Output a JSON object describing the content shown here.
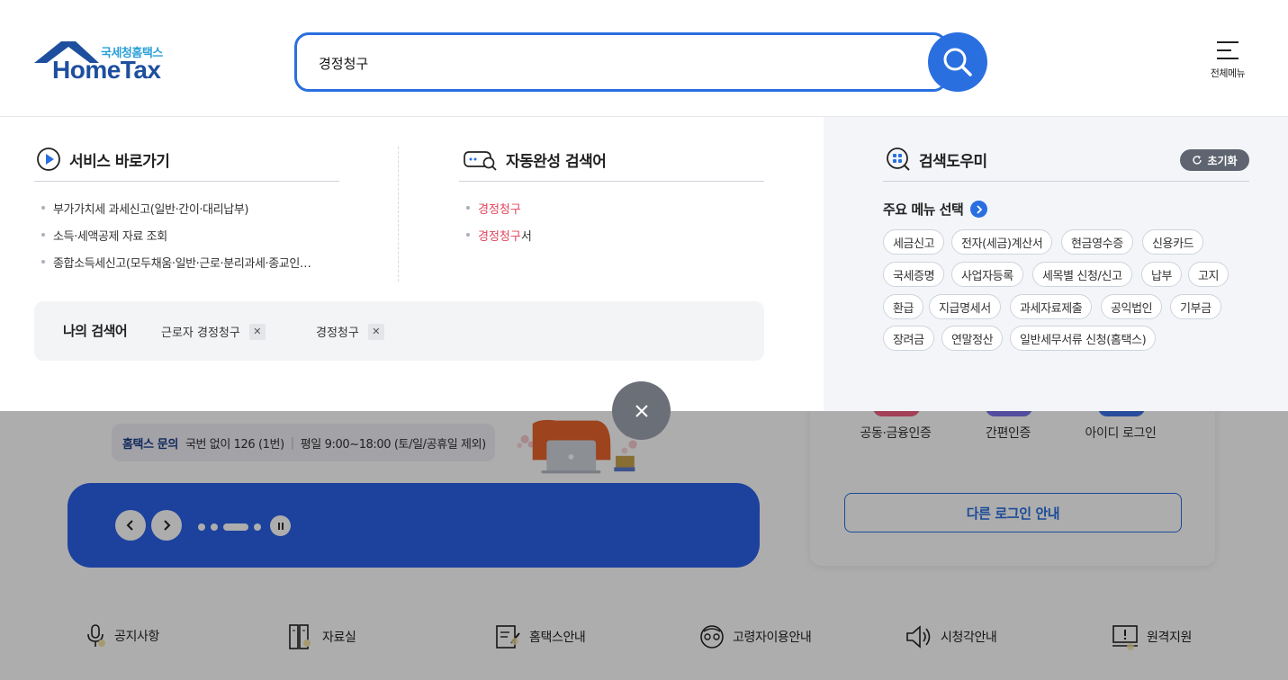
{
  "header": {
    "logo_sub": "국세청홈택스",
    "logo_main": "HomeTax",
    "search_value": "경정청구",
    "menu_label": "전체메뉴"
  },
  "services": {
    "title": "서비스 바로가기",
    "items": [
      "부가가치세 과세신고(일반·간이·대리납부)",
      "소득·세액공제 자료 조회",
      "종합소득세신고(모두채움·일반·근로·분리과세·종교인…"
    ]
  },
  "autocomplete": {
    "title": "자동완성 검색어",
    "items": [
      {
        "match": "경정청구",
        "rest": ""
      },
      {
        "match": "경정청구",
        "rest": "서"
      }
    ]
  },
  "my_search": {
    "title": "나의 검색어",
    "items": [
      "근로자 경정청구",
      "경정청구"
    ]
  },
  "helper": {
    "title": "검색도우미",
    "reset_label": "초기화",
    "subtitle": "주요 메뉴 선택",
    "tags": [
      "세금신고",
      "전자(세금)계산서",
      "현금영수증",
      "신용카드",
      "국세증명",
      "사업자등록",
      "세목별 신청/신고",
      "납부",
      "고지",
      "환급",
      "지급명세서",
      "과세자료제출",
      "공익법인",
      "기부금",
      "장려금",
      "연말정산",
      "일반세무서류 신청(홈택스)"
    ]
  },
  "background": {
    "inquiry_title": "홈택스 문의",
    "inquiry_phone": "국번 없이 126 (1번)",
    "inquiry_hours": "평일 9:00~18:00 (토/일/공휴일 제외)",
    "login_options": [
      "공동·금융인증",
      "간편인증",
      "아이디 로그인"
    ],
    "other_login": "다른 로그인 안내",
    "quick_links": [
      "공지사항",
      "자료실",
      "홈택스안내",
      "고령자이용안내",
      "시청각안내",
      "원격지원"
    ]
  },
  "colors": {
    "primary": "#2a6fe0",
    "highlight": "#e0455a",
    "banner": "#2a62e8",
    "panel_right_bg": "#f3f5f9"
  },
  "icons": [
    "search-icon",
    "menu-icon",
    "play-circle-icon",
    "chat-search-icon",
    "grid-search-icon",
    "refresh-icon",
    "chevron-right-icon",
    "close-icon",
    "microphone-icon",
    "archive-icon",
    "document-edit-icon",
    "senior-icon",
    "speaker-icon",
    "monitor-alert-icon"
  ]
}
